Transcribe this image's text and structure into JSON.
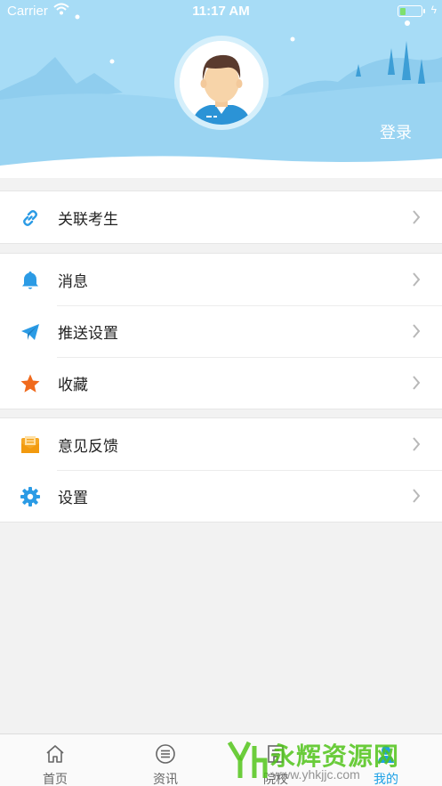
{
  "status_bar": {
    "carrier": "Carrier",
    "time": "11:17 AM",
    "battery_percent": 20
  },
  "header": {
    "login_label": "登录",
    "avatar_icon": "user-avatar-icon"
  },
  "menu": {
    "groups": [
      [
        {
          "label": "关联考生",
          "icon": "link-icon",
          "color": "#2b9be5"
        }
      ],
      [
        {
          "label": "消息",
          "icon": "bell-icon",
          "color": "#2b9be5"
        },
        {
          "label": "推送设置",
          "icon": "paper-plane-icon",
          "color": "#2b9be5"
        },
        {
          "label": "收藏",
          "icon": "star-icon",
          "color": "#f06a1d"
        }
      ],
      [
        {
          "label": "意见反馈",
          "icon": "mail-icon",
          "color": "#f5a623"
        },
        {
          "label": "设置",
          "icon": "gear-icon",
          "color": "#2b9be5"
        }
      ]
    ]
  },
  "tabs": [
    {
      "label": "首页",
      "icon": "home-icon",
      "active": false
    },
    {
      "label": "资讯",
      "icon": "list-icon",
      "active": false
    },
    {
      "label": "院校",
      "icon": "school-icon",
      "active": false
    },
    {
      "label": "我的",
      "icon": "person-icon",
      "active": true
    }
  ],
  "watermark": {
    "text": "永辉资源网",
    "url": "www.yhkjjc.com"
  },
  "colors": {
    "header_bg": "#a7dcf6",
    "accent": "#1da1e6",
    "page_bg": "#f2f2f2"
  }
}
